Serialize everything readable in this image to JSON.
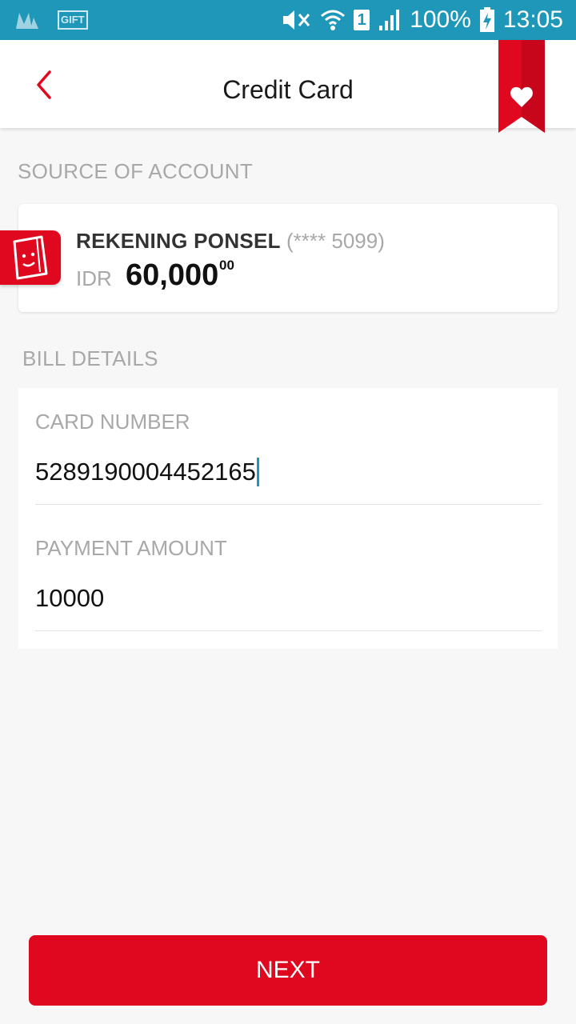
{
  "status_bar": {
    "battery": "100%",
    "time": "13:05",
    "gift_label": "GIFT",
    "sim_slot": "1"
  },
  "header": {
    "title": "Credit Card"
  },
  "source_account": {
    "section_label": "SOURCE OF ACCOUNT",
    "name": "REKENING PONSEL",
    "masked_number": "(**** 5099)",
    "currency": "IDR",
    "balance": "60,000",
    "balance_decimal": "00"
  },
  "bill_details": {
    "section_label": "BILL DETAILS",
    "card_number_label": "CARD NUMBER",
    "card_number_value": "5289190004452165",
    "payment_amount_label": "PAYMENT AMOUNT",
    "payment_amount_value": "10000"
  },
  "actions": {
    "next_label": "NEXT"
  },
  "colors": {
    "status_bar": "#1e97b8",
    "accent": "#e0081f"
  }
}
